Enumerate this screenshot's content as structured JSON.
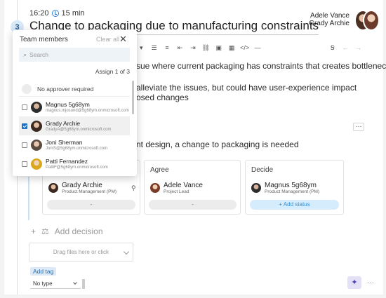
{
  "header": {
    "step_number": "3",
    "time": "16:20",
    "duration": "15 min",
    "title": "Change to packaging due to manufacturing constraints",
    "owners": [
      "Adele Vance",
      "Grady Archie"
    ]
  },
  "editor": {
    "lines": [
      "sue where current packaging has constraints that creates bottleneck in",
      "alleviate the issues, but could have user-experience impact",
      "osed changes"
    ],
    "statement": "nt design, a change to packaging is needed"
  },
  "approval": {
    "columns": [
      {
        "title": "",
        "name": "Grady Archie",
        "role": "Product Management (PM)",
        "status": "-"
      },
      {
        "title": "Agree",
        "name": "Adele Vance",
        "role": "Project Lead",
        "status": "-"
      },
      {
        "title": "Decide",
        "name": "Magnus 5g68ym",
        "role": "Product Management (PM)",
        "status": "+ Add status"
      }
    ]
  },
  "footer": {
    "add_decision": "Add decision",
    "dropzone": "Drag files here or click",
    "add_tag": "Add tag",
    "type_select": "No type"
  },
  "popup": {
    "header": "Team members",
    "clear_all": "Clear all",
    "close": "✕",
    "search_placeholder": "Search",
    "assign": "Assign 1 of 3",
    "no_approver": "No approver required",
    "members": [
      {
        "name": "Magnus 5g68ym",
        "email": "magnus.mjosund@5g68ym.onmicrosoft.com",
        "checked": false
      },
      {
        "name": "Grady Archie",
        "email": "GradyA@5g68ym.onmicrosoft.com",
        "checked": true
      },
      {
        "name": "Joni Sherman",
        "email": "JoniS@5g68ym.onmicrosoft.com",
        "checked": false
      },
      {
        "name": "Patti Fernandez",
        "email": "PattiF@5g68ym.onmicrosoft.com",
        "checked": false
      }
    ]
  },
  "colors": {
    "accent": "#1d6ec5",
    "badge_bg": "#d7e8f7",
    "add_status_bg": "#d4ecfb"
  }
}
